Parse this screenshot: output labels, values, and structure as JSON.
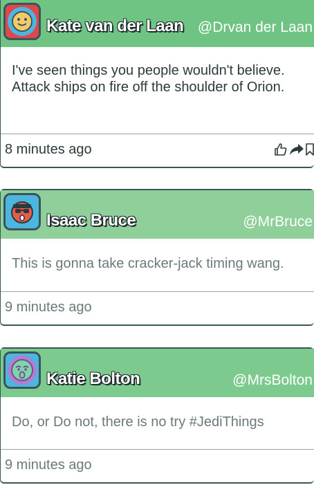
{
  "posts": [
    {
      "avatar_icon": "smiley-face-icon",
      "name": "Kate van der Laan",
      "handle": "@Drvan der Laan",
      "message": "I've seen things you people wouldn't believe. Attack ships on fire off the shoulder of Orion.",
      "timestamp": "8 minutes ago",
      "actions": [
        "thumbs-up-icon",
        "share-icon",
        "bookmark-icon"
      ]
    },
    {
      "avatar_icon": "cool-sunglasses-face-icon",
      "name": "Isaac Bruce",
      "handle": "@MrBruce",
      "message": "This is gonna take cracker-jack timing wang.",
      "timestamp": "9 minutes ago"
    },
    {
      "avatar_icon": "sleepy-face-icon",
      "name": "Katie Bolton",
      "handle": "@MrsBolton",
      "message": "Do, or Do not, there is no try #JediThings",
      "timestamp": "9 minutes ago"
    }
  ],
  "colors": {
    "header_green": "#6fc484",
    "border_dark": "#3a5558",
    "avatar_blue": "#4cb5e0",
    "avatar_red": "#e0474c"
  }
}
